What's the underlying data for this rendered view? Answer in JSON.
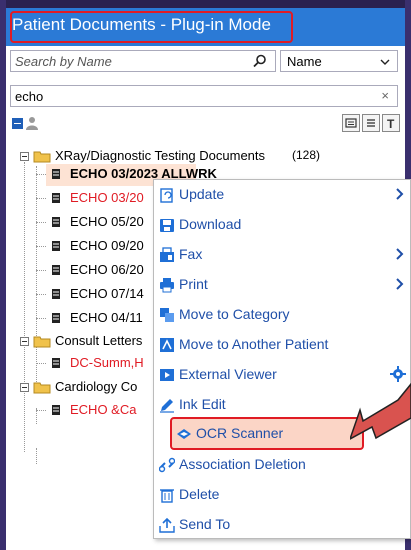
{
  "window": {
    "title": "Patient Documents - Plug-in Mode"
  },
  "search": {
    "placeholder": "Search by Name",
    "sort_value": "Name"
  },
  "filter": {
    "value": "echo",
    "clear_symbol": "×"
  },
  "tree": {
    "groups": [
      {
        "label": "XRay/Diagnostic Testing Documents",
        "count": "(128)",
        "items": [
          {
            "label": "ECHO 03/2023 ALLWRK",
            "style": "bold-selected"
          },
          {
            "label": "ECHO 03/20",
            "style": "red"
          },
          {
            "label": "ECHO 05/20",
            "style": "normal"
          },
          {
            "label": "ECHO 09/20",
            "style": "normal"
          },
          {
            "label": "ECHO 06/20",
            "style": "normal"
          },
          {
            "label": "ECHO 07/14",
            "style": "normal"
          },
          {
            "label": "ECHO 04/11",
            "style": "normal"
          }
        ]
      },
      {
        "label": "Consult Letters",
        "items": [
          {
            "label": "DC-Summ,H",
            "style": "red"
          }
        ]
      },
      {
        "label": "Cardiology Co",
        "items": [
          {
            "label": "ECHO &Ca",
            "style": "red"
          }
        ]
      }
    ]
  },
  "context_menu": {
    "items": [
      {
        "label": "Update",
        "icon": "update-icon",
        "submenu": true
      },
      {
        "label": "Download",
        "icon": "download-icon",
        "submenu": false
      },
      {
        "label": "Fax",
        "icon": "fax-icon",
        "submenu": true
      },
      {
        "label": "Print",
        "icon": "print-icon",
        "submenu": true
      },
      {
        "label": "Move to Category",
        "icon": "move-category-icon",
        "submenu": false
      },
      {
        "label": "Move to Another Patient",
        "icon": "move-patient-icon",
        "submenu": false
      },
      {
        "label": "External Viewer",
        "icon": "external-viewer-icon",
        "submenu": false,
        "gear": true
      },
      {
        "label": "Ink Edit",
        "icon": "pencil-icon",
        "submenu": false
      },
      {
        "label": "OCR Scanner",
        "icon": "ocr-icon",
        "submenu": false,
        "highlighted": true
      },
      {
        "label": "Association Deletion",
        "icon": "unlink-icon",
        "submenu": false,
        "hover": true
      },
      {
        "label": "Delete",
        "icon": "trash-icon",
        "submenu": false
      },
      {
        "label": "Send To",
        "icon": "send-icon",
        "submenu": false
      }
    ]
  },
  "colors": {
    "title_bar": "#2b7ad6",
    "menu_text": "#1f4fa8",
    "red_text": "#e01b24",
    "highlight_border": "#e01b24",
    "selected_row": "#fde3d4"
  }
}
